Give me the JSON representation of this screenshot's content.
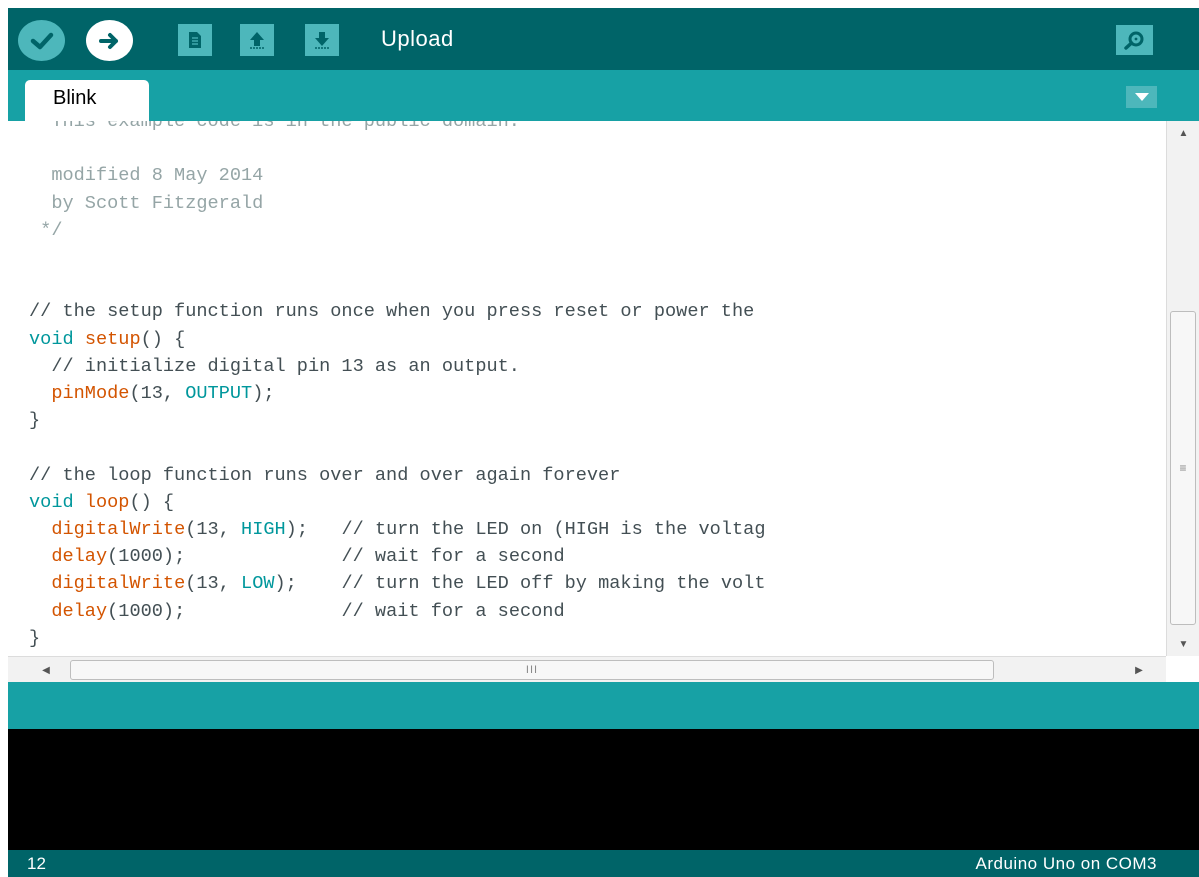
{
  "toolbar": {
    "hover_label": "Upload",
    "buttons": [
      {
        "name": "verify",
        "icon": "check-icon"
      },
      {
        "name": "upload",
        "icon": "arrow-right-icon"
      },
      {
        "name": "new",
        "icon": "new-file-icon"
      },
      {
        "name": "open",
        "icon": "arrow-up-icon"
      },
      {
        "name": "save",
        "icon": "arrow-down-icon"
      },
      {
        "name": "serial-monitor",
        "icon": "magnifier-icon"
      }
    ]
  },
  "tabs": [
    {
      "label": "Blink",
      "active": true
    }
  ],
  "editor": {
    "lines": [
      "  This example code is in the public domain.",
      "",
      "  modified 8 May 2014",
      "  by Scott Fitzgerald",
      " */",
      "",
      "",
      "// the setup function runs once when you press reset or power the",
      "void setup() {",
      "  // initialize digital pin 13 as an output.",
      "  pinMode(13, OUTPUT);",
      "}",
      "",
      "// the loop function runs over and over again forever",
      "void loop() {",
      "  digitalWrite(13, HIGH);   // turn the LED on (HIGH is the voltag",
      "  delay(1000);              // wait for a second",
      "  digitalWrite(13, LOW);    // turn the LED off by making the volt",
      "  delay(1000);              // wait for a second",
      "}"
    ]
  },
  "status": {
    "line_number": "12",
    "board": "Arduino Uno on COM3"
  },
  "colors": {
    "toolbar_bg": "#006468",
    "tabbar_bg": "#17a1a5",
    "button_bg": "#4db7bb",
    "console_bg": "#000000",
    "comment": "#95a5a6",
    "function": "#d35400",
    "keyword": "#00979c"
  }
}
